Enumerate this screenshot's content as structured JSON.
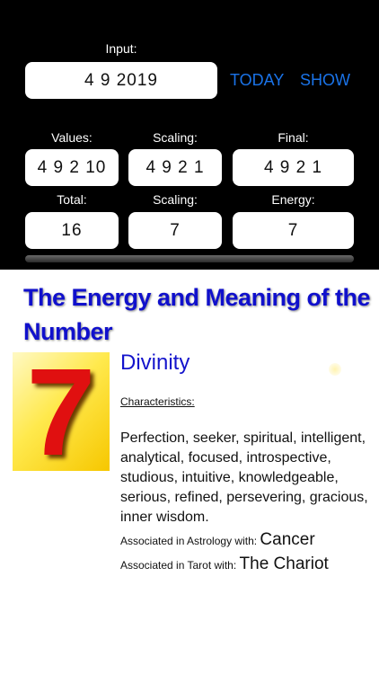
{
  "calculator": {
    "input_label": "Input:",
    "input_value": "4 9 2019",
    "today_label": "TODAY",
    "show_label": "SHOW",
    "row1": {
      "labels": [
        "Values:",
        "Scaling:",
        "Final:"
      ],
      "values": [
        "4 9 2 10",
        "4 9 2 1",
        "4 9 2 1"
      ]
    },
    "row2": {
      "labels": [
        "Total:",
        "Scaling:",
        "Energy:"
      ],
      "values": [
        "16",
        "7",
        "7"
      ]
    }
  },
  "meaning": {
    "heading": "The Energy and Meaning of the Number",
    "number": "7",
    "title": "Divinity",
    "characteristics_label": "Characteristics:",
    "characteristics": "Perfection, seeker, spiritual, intelligent, analytical, focused, introspective, studious, intuitive, knowledgeable, serious, refined, persevering, gracious, inner wisdom.",
    "astrology_label": "Associated in Astrology with: ",
    "astrology_value": "Cancer",
    "tarot_label": "Associated in Tarot with: ",
    "tarot_value": "The Chariot"
  },
  "colors": {
    "accent_blue": "#1a73e8",
    "heading_blue": "#1010cc",
    "number_red": "#e01010",
    "tile_yellow": "#ffe94d"
  }
}
